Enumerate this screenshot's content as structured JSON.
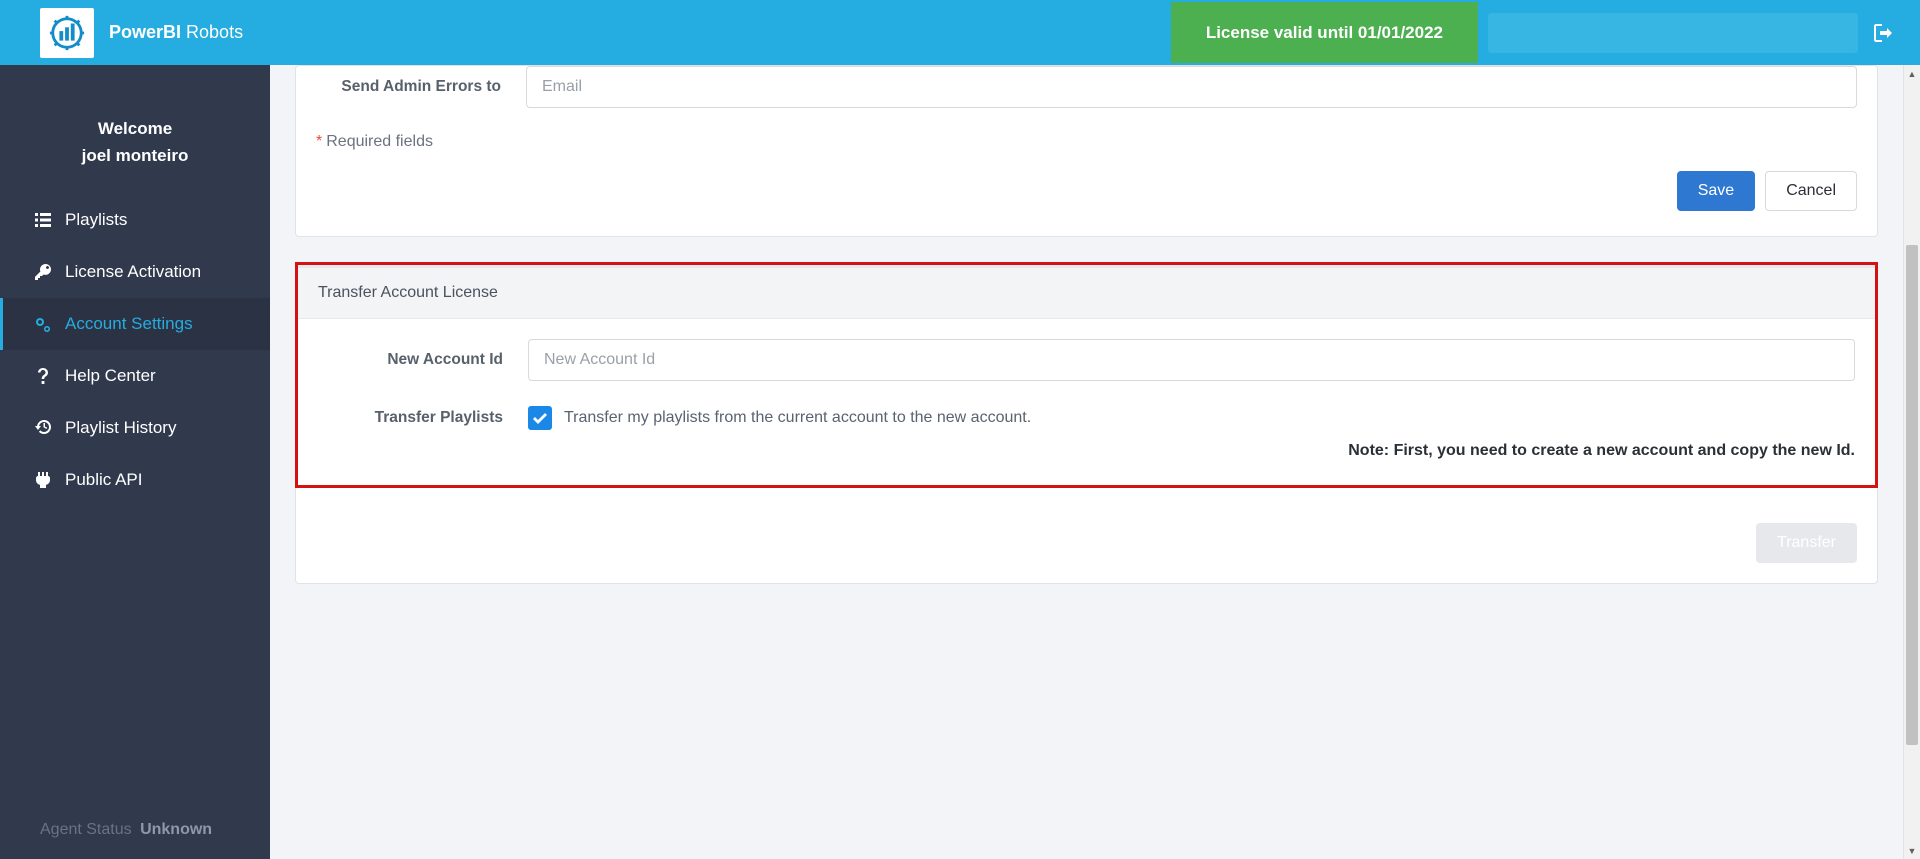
{
  "brand": {
    "strong": "PowerBI",
    "rest": " Robots"
  },
  "license_banner": "License valid until 01/01/2022",
  "welcome": {
    "line1": "Welcome",
    "line2": "joel monteiro"
  },
  "nav": {
    "playlists": "Playlists",
    "license_activation": "License Activation",
    "account_settings": "Account Settings",
    "help_center": "Help Center",
    "playlist_history": "Playlist History",
    "public_api": "Public API"
  },
  "agent_status": {
    "label": "Agent Status",
    "value": "Unknown"
  },
  "panel1": {
    "admin_errors_label": "Send Admin Errors to",
    "admin_errors_placeholder": "Email",
    "required_fields": "Required fields",
    "save": "Save",
    "cancel": "Cancel"
  },
  "panel2": {
    "title": "Transfer Account License",
    "new_account_label": "New Account Id",
    "new_account_placeholder": "New Account Id",
    "transfer_playlists_label": "Transfer Playlists",
    "transfer_playlists_desc": "Transfer my playlists from the current account to the new account.",
    "note": "Note: First, you need to create a new account and copy the new Id.",
    "transfer_btn": "Transfer"
  }
}
